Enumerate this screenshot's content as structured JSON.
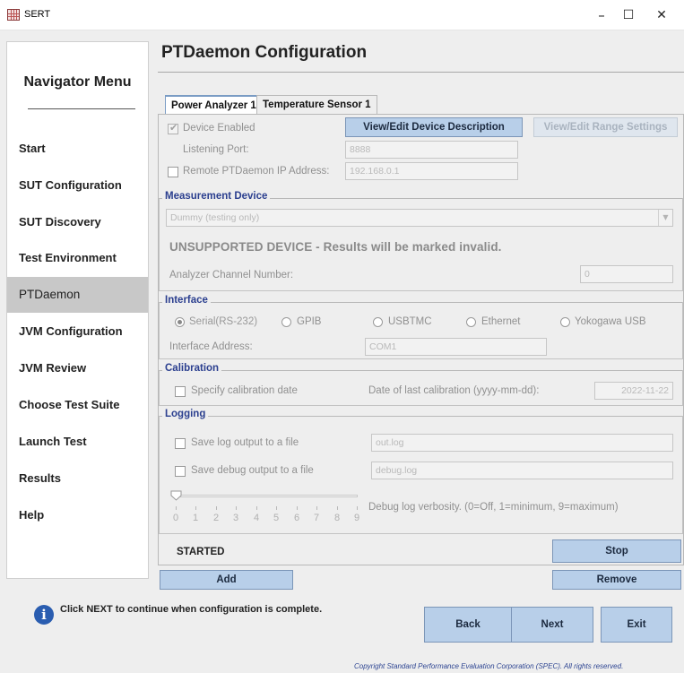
{
  "window": {
    "title": "SERT",
    "minimize_glyph": "–",
    "maximize_glyph": "☐",
    "close_glyph": "✕"
  },
  "nav": {
    "title": "Navigator Menu",
    "items": [
      {
        "label": "Start"
      },
      {
        "label": "SUT Configuration"
      },
      {
        "label": "SUT Discovery"
      },
      {
        "label": "Test Environment"
      },
      {
        "label": "PTDaemon",
        "active": true
      },
      {
        "label": "JVM Configuration"
      },
      {
        "label": "JVM Review"
      },
      {
        "label": "Choose Test Suite"
      },
      {
        "label": "Launch Test"
      },
      {
        "label": "Results"
      },
      {
        "label": "Help"
      }
    ]
  },
  "page": {
    "title": "PTDaemon Configuration"
  },
  "tabs": [
    {
      "label": "Power Analyzer 1",
      "active": true
    },
    {
      "label": "Temperature Sensor 1",
      "active": false
    }
  ],
  "device": {
    "enabled_label": "Device Enabled",
    "enabled_checked": true,
    "view_description_label": "View/Edit Device Description",
    "view_range_label": "View/Edit Range Settings",
    "listening_port_label": "Listening Port:",
    "listening_port_value": "8888",
    "remote_ip_label": "Remote PTDaemon IP Address:",
    "remote_ip_checked": false,
    "remote_ip_value": "192.168.0.1"
  },
  "measurement": {
    "legend": "Measurement Device",
    "selected_device": "Dummy (testing only)",
    "warning": "UNSUPPORTED DEVICE - Results will be marked invalid.",
    "channel_label": "Analyzer Channel Number:",
    "channel_value": "0"
  },
  "interface": {
    "legend": "Interface",
    "options": [
      {
        "label": "Serial(RS-232)",
        "selected": true
      },
      {
        "label": "GPIB",
        "selected": false
      },
      {
        "label": "USBTMC",
        "selected": false
      },
      {
        "label": "Ethernet",
        "selected": false
      },
      {
        "label": "Yokogawa USB",
        "selected": false
      }
    ],
    "address_label": "Interface Address:",
    "address_value": "COM1"
  },
  "calibration": {
    "legend": "Calibration",
    "specify_label": "Specify calibration date",
    "specify_checked": false,
    "last_date_label": "Date of last calibration (yyyy-mm-dd):",
    "last_date_value": "2022-11-22"
  },
  "logging": {
    "legend": "Logging",
    "save_log_label": "Save log output to a file",
    "save_log_checked": false,
    "log_file": "out.log",
    "save_debug_label": "Save debug output to a file",
    "save_debug_checked": false,
    "debug_file": "debug.log",
    "verbosity_value": 0,
    "verbosity_ticks": [
      "0",
      "1",
      "2",
      "3",
      "4",
      "5",
      "6",
      "7",
      "8",
      "9"
    ],
    "verbosity_label": "Debug log verbosity. (0=Off, 1=minimum, 9=maximum)"
  },
  "status": {
    "text": "STARTED",
    "stop_label": "Stop"
  },
  "actions": {
    "add_label": "Add",
    "remove_label": "Remove"
  },
  "footer": {
    "info_glyph": "i",
    "info_text": "Click NEXT to continue when configuration is complete.",
    "back_label": "Back",
    "next_label": "Next",
    "exit_label": "Exit",
    "copyright": "Copyright Standard Performance Evaluation Corporation (SPEC). All rights reserved."
  },
  "colors": {
    "accent_button": "#b8cfe9",
    "legend_text": "#2b3f8f",
    "nav_active": "#c8c8c8",
    "info_icon": "#2a5db0"
  }
}
